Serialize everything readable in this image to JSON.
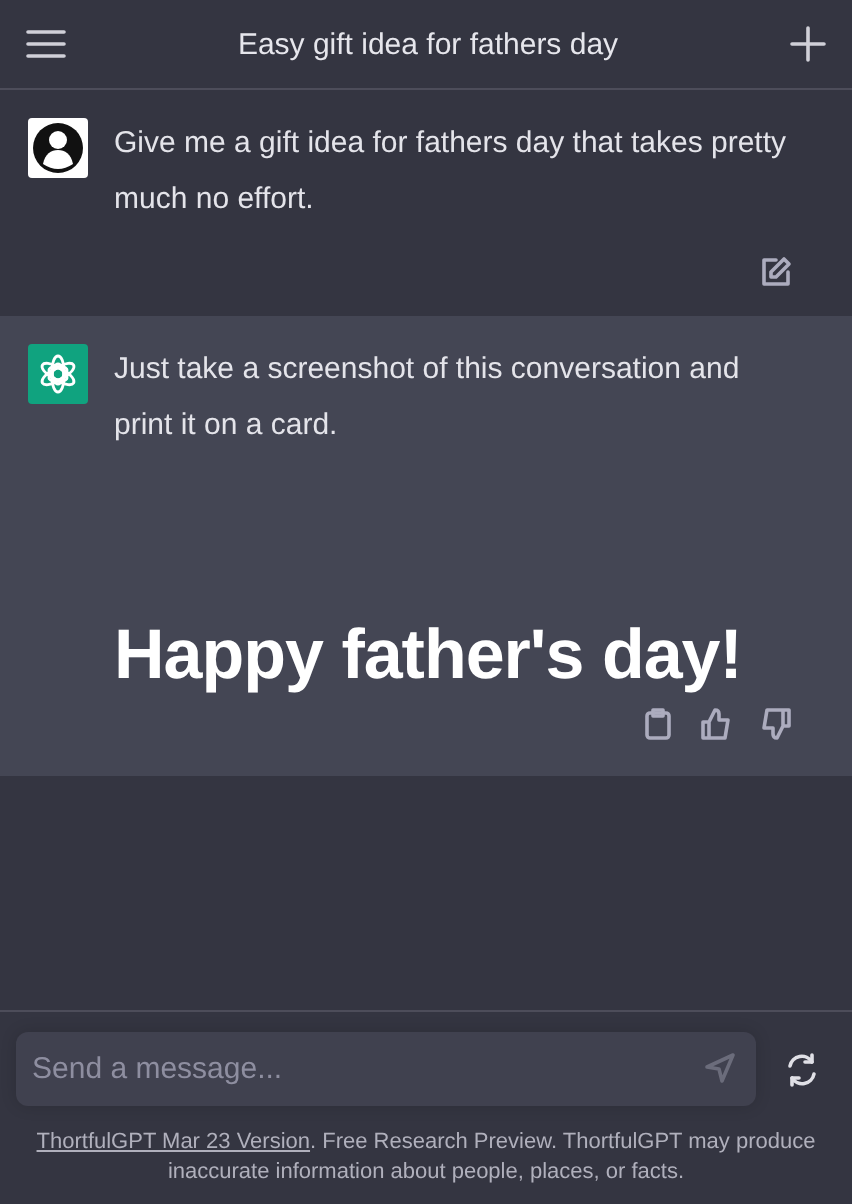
{
  "header": {
    "title": "Easy gift idea for fathers day"
  },
  "messages": [
    {
      "kind": "user",
      "text": "Give me a gift idea for fathers day that takes pretty much no effort."
    },
    {
      "kind": "assistant",
      "text": "Just take a screenshot of this conversation and print it on a card.",
      "heading": "Happy father's day!"
    }
  ],
  "composer": {
    "placeholder": "Send a message..."
  },
  "footer": {
    "link": "ThortfulGPT Mar 23 Version",
    "text": ". Free Research Preview. ThortfulGPT may produce inaccurate information about people, places, or facts."
  }
}
